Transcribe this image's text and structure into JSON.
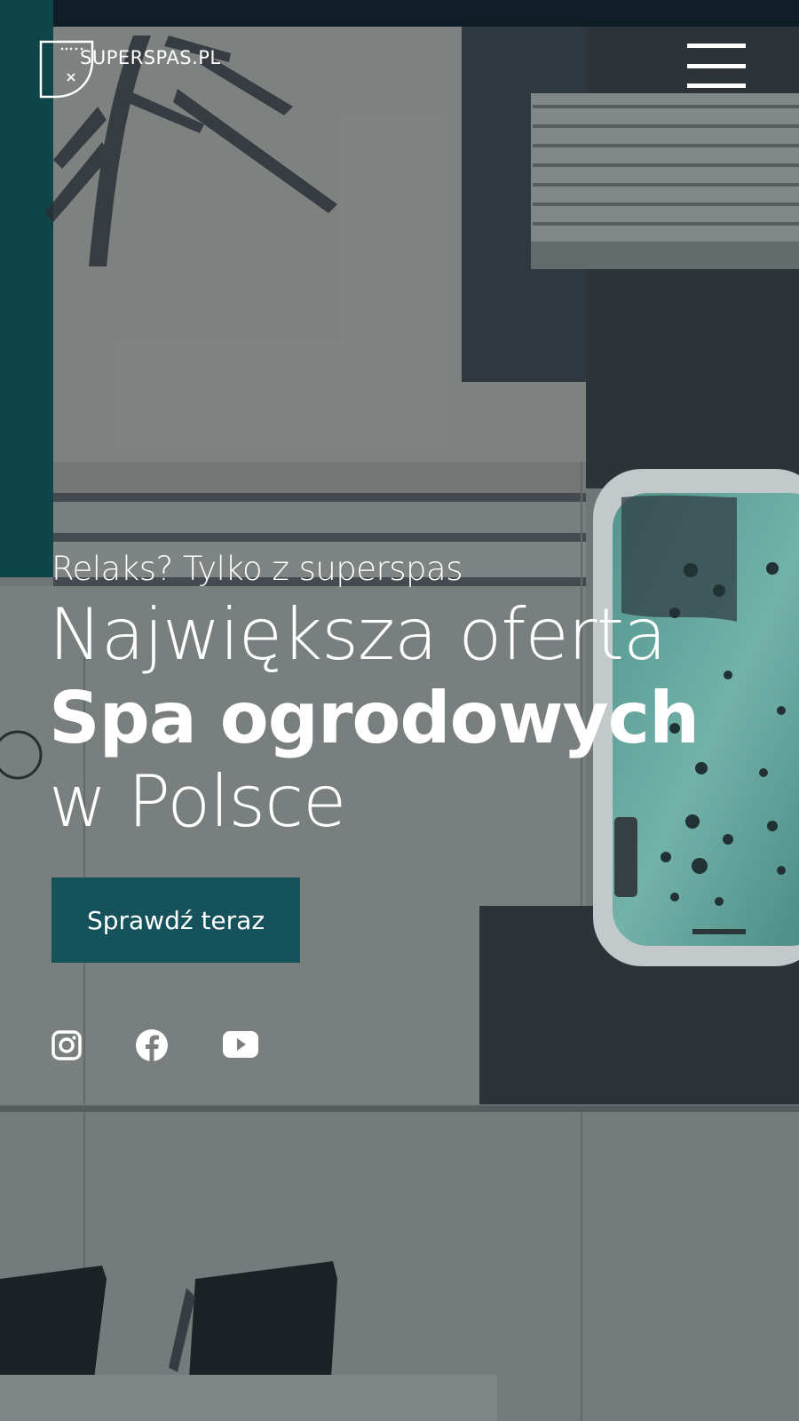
{
  "brand": {
    "name": "SUPERSPAS.PL"
  },
  "hero": {
    "tagline": "Relaks? Tylko z superspas",
    "headline_line1": "Największa oferta",
    "headline_line2": "Spa ogrodowych",
    "headline_line3": "w Polsce",
    "cta_label": "Sprawdź teraz"
  },
  "colors": {
    "accent": "#16525b",
    "text": "#ffffff",
    "teal_edge": "#0e4a4d"
  },
  "social": [
    {
      "name": "instagram-icon"
    },
    {
      "name": "facebook-icon"
    },
    {
      "name": "youtube-icon"
    }
  ]
}
